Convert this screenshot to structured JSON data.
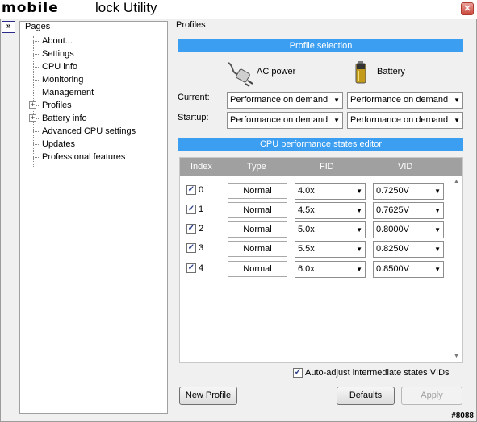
{
  "window": {
    "logo": "mobile",
    "title": "lock Utility",
    "close_glyph": "✕"
  },
  "nav": {
    "collapse_glyph": "»",
    "pages_title": "Pages",
    "items": [
      {
        "label": "About...",
        "expandable": false
      },
      {
        "label": "Settings",
        "expandable": false
      },
      {
        "label": "CPU info",
        "expandable": false
      },
      {
        "label": "Monitoring",
        "expandable": false
      },
      {
        "label": "Management",
        "expandable": false
      },
      {
        "label": "Profiles",
        "expandable": true
      },
      {
        "label": "Battery info",
        "expandable": true
      },
      {
        "label": "Advanced CPU settings",
        "expandable": false
      },
      {
        "label": "Updates",
        "expandable": false
      },
      {
        "label": "Professional features",
        "expandable": false
      }
    ]
  },
  "profiles": {
    "section_label": "Profiles",
    "profile_selection_header": "Profile selection",
    "ac_power_label": "AC power",
    "battery_label": "Battery",
    "ac_icon": "plug-icon",
    "battery_icon": "battery-icon",
    "current_label": "Current:",
    "startup_label": "Startup:",
    "current_ac": "Performance on demand",
    "current_battery": "Performance on demand",
    "startup_ac": "Performance on demand",
    "startup_battery": "Performance on demand"
  },
  "pstates": {
    "header": "CPU performance states editor",
    "columns": {
      "index": "Index",
      "type": "Type",
      "fid": "FID",
      "vid": "VID"
    },
    "rows": [
      {
        "checked": true,
        "index": "0",
        "type": "Normal",
        "fid": "4.0x",
        "vid": "0.7250V"
      },
      {
        "checked": true,
        "index": "1",
        "type": "Normal",
        "fid": "4.5x",
        "vid": "0.7625V"
      },
      {
        "checked": true,
        "index": "2",
        "type": "Normal",
        "fid": "5.0x",
        "vid": "0.8000V"
      },
      {
        "checked": true,
        "index": "3",
        "type": "Normal",
        "fid": "5.5x",
        "vid": "0.8250V"
      },
      {
        "checked": true,
        "index": "4",
        "type": "Normal",
        "fid": "6.0x",
        "vid": "0.8500V"
      }
    ],
    "auto_adjust_label": "Auto-adjust intermediate states VIDs",
    "auto_adjust_checked": true
  },
  "buttons": {
    "new_profile": "New Profile",
    "defaults": "Defaults",
    "apply": "Apply"
  },
  "watermark": "#8088",
  "colors": {
    "accent": "#3c9ef0",
    "grid_header": "#a0a0a0"
  }
}
